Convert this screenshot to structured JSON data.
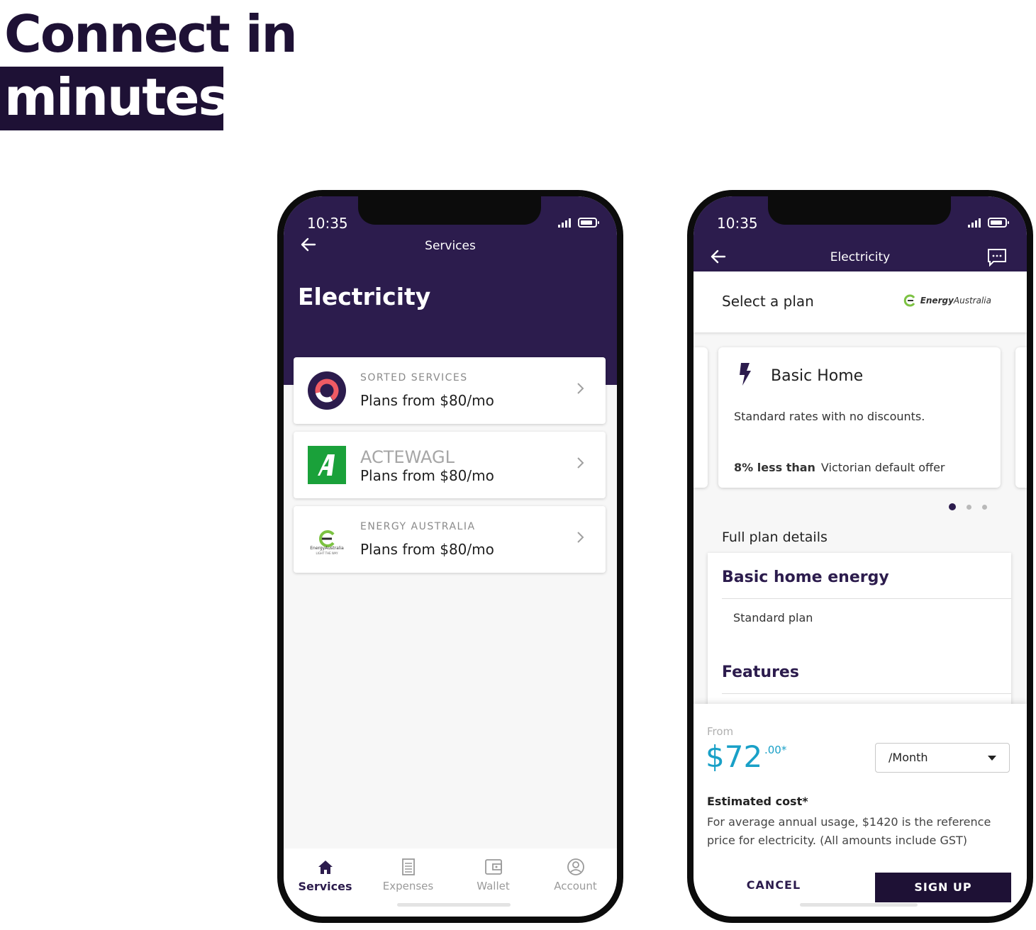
{
  "headline": {
    "line1": "Connect in",
    "line2": "minutes"
  },
  "phone1": {
    "status": {
      "time": "10:35"
    },
    "header": {
      "title": "Services",
      "heading": "Electricity"
    },
    "providers": [
      {
        "name": "SORTED SERVICES",
        "plans": "Plans from $80/mo",
        "logo": "sorted-logo"
      },
      {
        "name": "ACTEWAGL",
        "plans": "Plans from $80/mo",
        "logo": "actewagl-logo"
      },
      {
        "name": "ENERGY AUSTRALIA",
        "plans": "Plans from $80/mo",
        "logo": "energyaustralia-logo",
        "logo_text": "EnergyAustralia",
        "logo_tagline": "LIGHT THE WAY"
      }
    ],
    "tabs": [
      {
        "label": "Services",
        "icon": "home-icon",
        "active": true
      },
      {
        "label": "Expenses",
        "icon": "receipt-icon",
        "active": false
      },
      {
        "label": "Wallet",
        "icon": "wallet-icon",
        "active": false
      },
      {
        "label": "Account",
        "icon": "account-icon",
        "active": false
      }
    ]
  },
  "phone2": {
    "status": {
      "time": "10:35"
    },
    "header": {
      "title": "Electricity"
    },
    "select_plan": {
      "label": "Select a plan",
      "brand_bold": "Energy",
      "brand_rest": "Australia"
    },
    "plan_card": {
      "title": "Basic Home",
      "description": "Standard rates with no discounts.",
      "compare_bold": "8% less than",
      "compare_text": "Victorian default offer",
      "page_count": 3,
      "active_page": 1
    },
    "full_details": {
      "label": "Full plan details",
      "title": "Basic home energy",
      "subtitle": "Standard plan",
      "features_title": "Features"
    },
    "pricing": {
      "from": "From",
      "price": "$72",
      "cents": ".00*",
      "period": "/Month",
      "estimated_title": "Estimated cost*",
      "estimated_note": "For average annual usage, $1420 is the reference price for electricity. (All amounts include GST)"
    },
    "actions": {
      "cancel": "CANCEL",
      "signup": "SIGN UP"
    }
  },
  "colors": {
    "brand_dark": "#1e1135",
    "header": "#2c1c4d",
    "price": "#19a0c7",
    "sorted_red": "#ef5b64",
    "actewagl_green": "#1aa13a",
    "ea_green": "#7cc242"
  }
}
